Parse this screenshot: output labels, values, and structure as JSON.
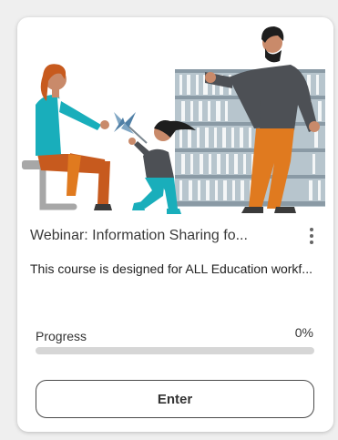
{
  "card": {
    "title": "Webinar: Information Sharing fo...",
    "description": "This course is designed for ALL Education workf...",
    "progress_label": "Progress",
    "progress_value": "0%",
    "progress_fraction": 0,
    "enter_label": "Enter",
    "more_icon": "vertical-ellipsis-icon",
    "illustration_icon": "people-library-illustration"
  },
  "colors": {
    "accent": "#1a73e8",
    "teal": "#19aebb",
    "orange": "#e07a1f",
    "shelf": "#9aa9b3"
  }
}
